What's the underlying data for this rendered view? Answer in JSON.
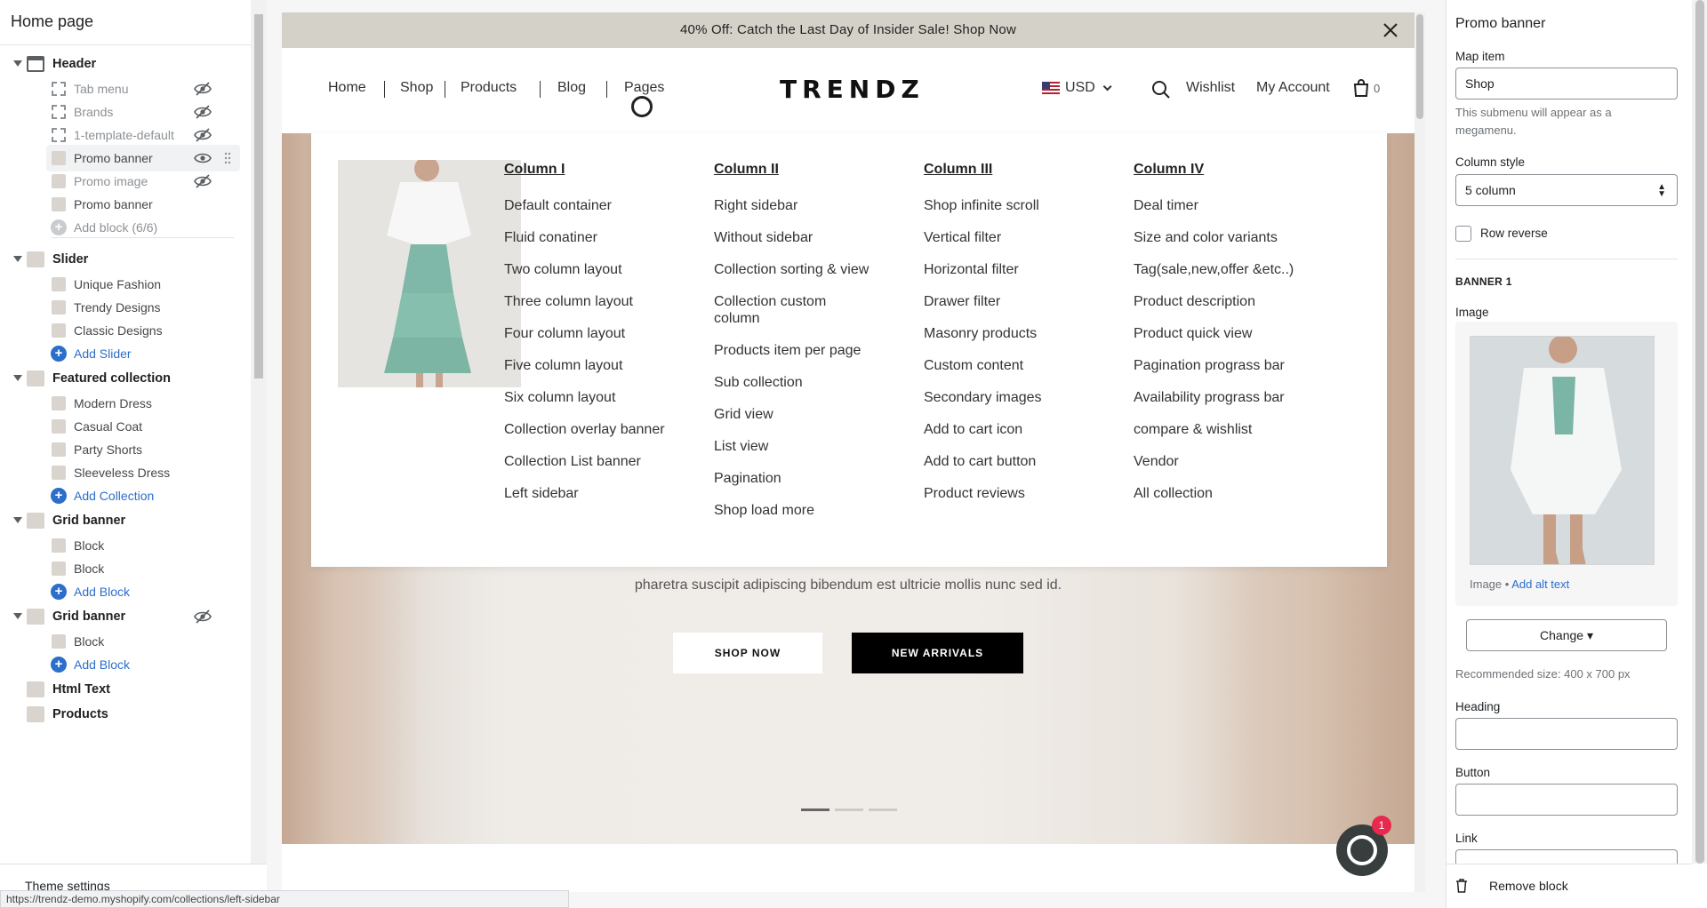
{
  "sidebar": {
    "title": "Home page",
    "sections": [
      {
        "label": "Header",
        "blocks": [
          {
            "label": "Tab menu",
            "hidden": true
          },
          {
            "label": "Brands",
            "hidden": true
          },
          {
            "label": "1-template-default",
            "hidden": true
          },
          {
            "label": "Promo banner",
            "hidden": false,
            "active": true
          },
          {
            "label": "Promo image",
            "hidden": true
          },
          {
            "label": "Promo banner",
            "hidden": false
          }
        ],
        "add": "Add block (6/6)"
      },
      {
        "label": "Slider",
        "blocks": [
          {
            "label": "Unique Fashion"
          },
          {
            "label": "Trendy Designs"
          },
          {
            "label": "Classic Designs"
          }
        ],
        "add": "Add Slider"
      },
      {
        "label": "Featured collection",
        "blocks": [
          {
            "label": "Modern Dress"
          },
          {
            "label": "Casual Coat"
          },
          {
            "label": "Party Shorts"
          },
          {
            "label": "Sleeveless Dress"
          }
        ],
        "add": "Add Collection"
      },
      {
        "label": "Grid banner",
        "blocks": [
          {
            "label": "Block"
          },
          {
            "label": "Block"
          }
        ],
        "add": "Add Block"
      },
      {
        "label": "Grid banner",
        "hidden": true,
        "blocks": [
          {
            "label": "Block"
          }
        ],
        "add": "Add Block"
      },
      {
        "label": "Html Text"
      },
      {
        "label": "Products"
      }
    ],
    "theme_settings": "Theme settings"
  },
  "preview": {
    "announcement": "40% Off: Catch the Last Day of Insider Sale! Shop Now",
    "nav": {
      "links": [
        "Home",
        "Shop",
        "Products",
        "Blog",
        "Pages"
      ],
      "logo": "TRENDZ",
      "currency": "USD",
      "wishlist": "Wishlist",
      "account": "My Account",
      "cart_count": "0"
    },
    "mega_menu": {
      "columns": [
        {
          "title": "Column I",
          "items": [
            "Default container",
            "Fluid conatiner",
            "Two column layout",
            "Three column layout",
            "Four column layout",
            "Five column layout",
            "Six column layout",
            "Collection overlay banner",
            "Collection List banner",
            "Left sidebar"
          ]
        },
        {
          "title": "Column II",
          "items": [
            "Right sidebar",
            "Without sidebar",
            "Collection sorting & view",
            "Collection custom column",
            "Products item per page",
            "Sub collection",
            "Grid view",
            "List view",
            "Pagination",
            "Shop load more"
          ]
        },
        {
          "title": "Column III",
          "items": [
            "Shop infinite scroll",
            "Vertical filter",
            "Horizontal filter",
            "Drawer filter",
            "Masonry products",
            "Custom content",
            "Secondary images",
            "Add to cart icon",
            "Add to cart button",
            "Product reviews"
          ]
        },
        {
          "title": "Column IV",
          "items": [
            "Deal timer",
            "Size and color variants",
            "Tag(sale,new,offer &etc..)",
            "Product description",
            "Product quick view",
            "Pagination prograss bar",
            "Availability prograss bar",
            "compare & wishlist",
            "Vendor",
            "All collection"
          ]
        }
      ]
    },
    "hero": {
      "subtitle": "pharetra suscipit adipiscing bibendum est ultricie mollis nunc sed id.",
      "btn_primary": "SHOP NOW",
      "btn_secondary": "NEW ARRIVALS",
      "active_slide": 1,
      "slide_count": 3
    },
    "chat_badge": "1",
    "status_url": "https://trendz-demo.myshopify.com/collections/left-sidebar"
  },
  "panel": {
    "title": "Promo banner",
    "map_item_label": "Map item",
    "map_item_value": "Shop",
    "map_item_help": "This submenu will appear as a megamenu.",
    "column_style_label": "Column style",
    "column_style_value": "5 column",
    "row_reverse_label": "Row reverse",
    "row_reverse_checked": false,
    "banner_heading": "BANNER 1",
    "image_label": "Image",
    "image_caption": "Image",
    "alt_text_link": "Add alt text",
    "change_button": "Change",
    "recommended": "Recommended size: 400 x 700 px",
    "heading_label": "Heading",
    "heading_value": "",
    "button_label": "Button",
    "button_value": "",
    "link_label": "Link",
    "remove_block": "Remove block"
  },
  "colors": {
    "accent": "#2c6ecb",
    "announcement_bg": "#d4d1c9",
    "chat_badge": "#e8294d"
  }
}
